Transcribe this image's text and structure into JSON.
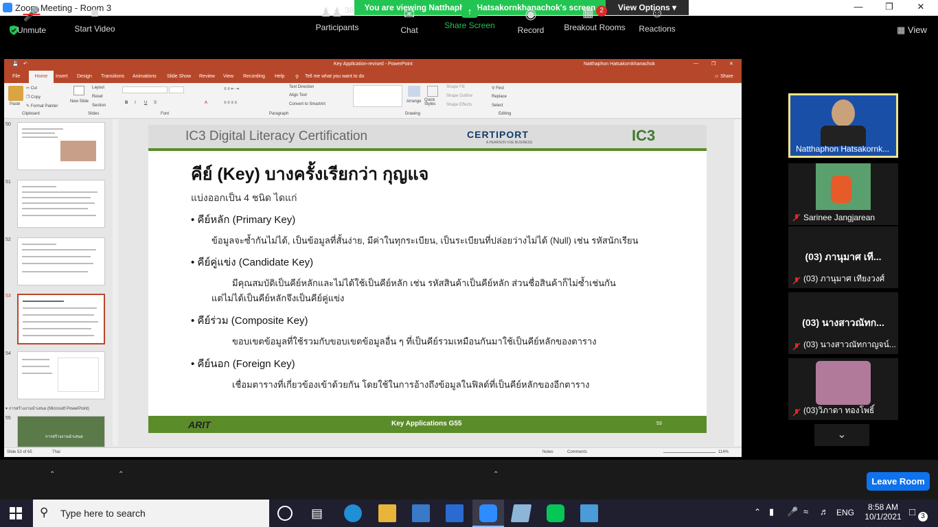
{
  "window": {
    "title": "Zoom Meeting - Room 3",
    "banner": "You are viewing Natthaphon Hatsakornkhanachok's screen",
    "view_options": "View Options",
    "view_btn": "View"
  },
  "ppt": {
    "doc_title": "Key Application-revised  -  PowerPoint",
    "user": "Natthaphon Hatsakornkhanachok",
    "tabs": [
      "File",
      "Home",
      "Insert",
      "Design",
      "Transitions",
      "Animations",
      "Slide Show",
      "Review",
      "View",
      "Recording",
      "Help"
    ],
    "tell_me": "Tell me what you want to do",
    "share": "Share",
    "groups": {
      "clipboard": "Clipboard",
      "slides": "Slides",
      "font": "Font",
      "paragraph": "Paragraph",
      "drawing": "Drawing",
      "editing": "Editing"
    },
    "ribbon": {
      "paste": "Paste",
      "cut": "Cut",
      "copy": "Copy",
      "format_painter": "Format Painter",
      "new_slide": "New Slide",
      "layout": "Layout",
      "reset": "Reset",
      "section": "Section",
      "text_direction": "Text Direction",
      "align_text": "Align Text",
      "convert": "Convert to SmartArt",
      "arrange": "Arrange",
      "quick_styles": "Quick Styles",
      "shape_fill": "Shape Fill",
      "shape_outline": "Shape Outline",
      "shape_effects": "Shape Effects",
      "find": "Find",
      "replace": "Replace",
      "select": "Select"
    },
    "thumb_numbers": [
      "50",
      "51",
      "52",
      "53",
      "54",
      "55"
    ],
    "section_label": "การสร้างงานนำเสนอ (Microsoft PowerPoint)",
    "thumb55_text": "การสร้างงานนำเสนอ",
    "status": {
      "slide": "Slide 53 of 65",
      "lang": "Thai",
      "notes": "Notes",
      "comments": "Comments",
      "zoom": "114%"
    }
  },
  "slide": {
    "header": "IC3 Digital Literacy Certification",
    "certiport": "CERTIPORT",
    "certiport_sub": "A PEARSON VUE BUSINESS",
    "ic3": "IC3",
    "title": "คีย์ (Key) บางครั้งเรียกว่า กุญแจ",
    "subtitle": "แบ่งออกเป็น 4 ชนิด ไดแก่",
    "items": [
      {
        "head": "คีย์หลัก (Primary Key)",
        "body": "ข้อมูลจะซ้ำกันไม่ได้, เป็นข้อมูลที่สั้นง่าย, มีค่าในทุกระเบียน, เป็นระเบียนที่ปล่อยว่างไม่ได้ (Null) เช่น รหัสนักเรียน"
      },
      {
        "head": "คีย์คู่แข่ง (Candidate Key)",
        "body": "มีคุณสมบัติเป็นคีย์หลักและไม่ได้ใช้เป็นคีย์หลัก เช่น รหัสสินค้าเป็นคีย์หลัก ส่วนชื่อสินค้าก็ไม่ซ้ำเช่นกัน",
        "body2": "แต่ไม่ได้เป็นคีย์หลักจึงเป็นคีย์คู่แข่ง"
      },
      {
        "head": "คีย์ร่วม (Composite Key)",
        "body": "ขอบเขตข้อมูลที่ใช้รวมกับขอบเขตข้อมูลอื่น ๆ ที่เป็นคีย์รวมเหมือนกันมาใช้เป็นคีย์หลักของตาราง"
      },
      {
        "head": "คีย์นอก (Foreign Key)",
        "body": "เชื่อมตารางที่เกี่ยวข้องเข้าด้วยกัน โดยใช้ในการอ้างถึงข้อมูลในฟิลด์ที่เป็นคีย์หลักของอีกตาราง"
      }
    ],
    "footer_logo": "ARIT",
    "footer_text": "Key Applications G55",
    "footer_num": "53"
  },
  "gallery": [
    {
      "name": "Natthaphon Hatsakornk...",
      "muted": false
    },
    {
      "name": "Sarinee Jangjarean",
      "muted": true
    },
    {
      "big": "(03) ภานุมาศ เที...",
      "name": "(03) ภานุมาศ เทียงวงศ์",
      "muted": true
    },
    {
      "big": "(03) นางสาวณัทก...",
      "name": "(03) นางสาวณัทกาญจน์...",
      "muted": true
    },
    {
      "name": "(03)วิภาดา ทองโพธิ์",
      "muted": true
    }
  ],
  "toolbar": {
    "unmute": "Unmute",
    "start_video": "Start Video",
    "participants": "Participants",
    "participants_count": "38",
    "chat": "Chat",
    "share": "Share Screen",
    "record": "Record",
    "breakout": "Breakout Rooms",
    "breakout_badge": "2",
    "reactions": "Reactions",
    "leave": "Leave Room"
  },
  "taskbar": {
    "search": "Type here to search",
    "lang": "ENG",
    "time": "8:58 AM",
    "date": "10/1/2021",
    "notif": "3"
  },
  "colors": {
    "ppt_accent": "#b7472a",
    "zoom_green": "#23c552",
    "zoom_blue": "#0e72ed",
    "slide_green": "#5b8c2a"
  }
}
